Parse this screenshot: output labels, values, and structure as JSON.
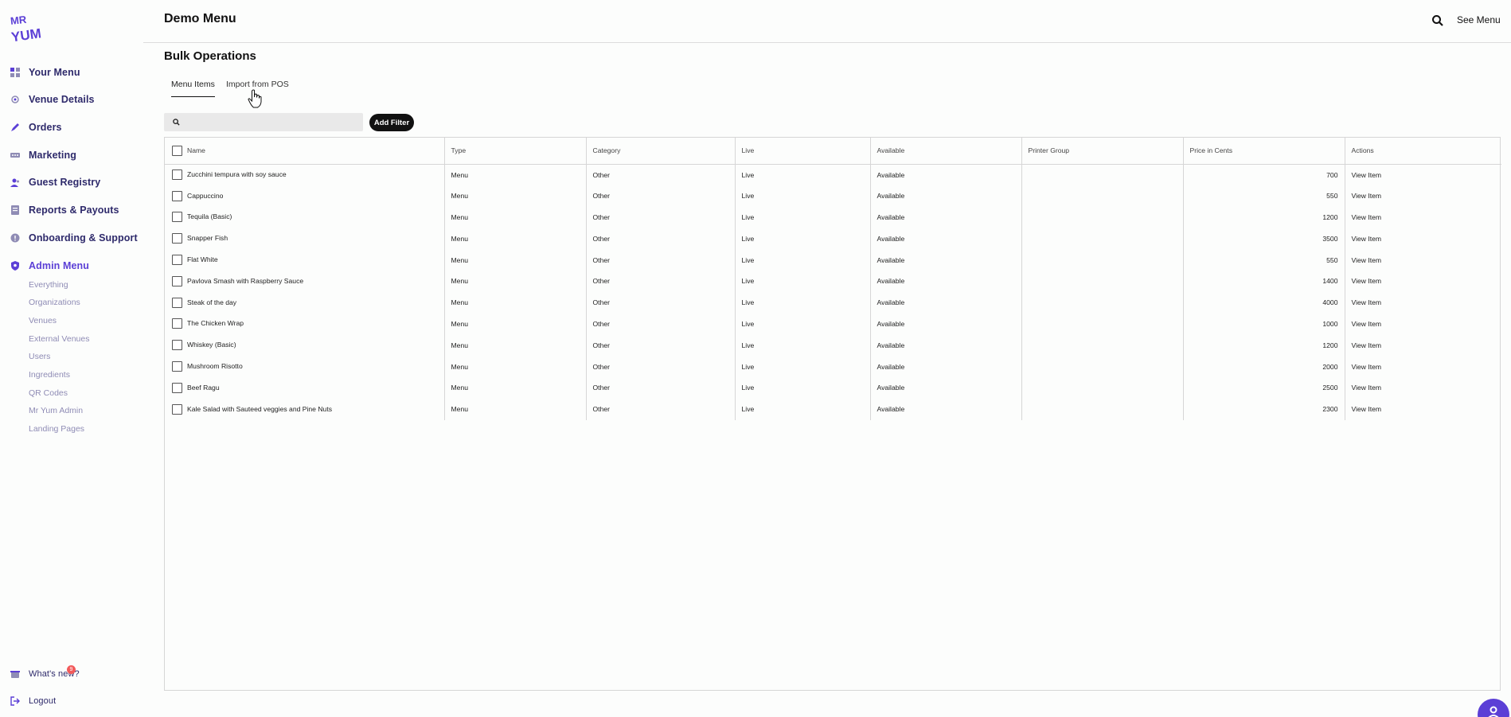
{
  "brand": {
    "logo_text_top": "MR",
    "logo_text_bottom": "YUM",
    "accent": "#5b3fd6"
  },
  "sidebar": {
    "items": [
      {
        "label": "Your Menu",
        "icon": "grid-icon"
      },
      {
        "label": "Venue Details",
        "icon": "store-icon"
      },
      {
        "label": "Orders",
        "icon": "pencil-icon"
      },
      {
        "label": "Marketing",
        "icon": "megaphone-icon"
      },
      {
        "label": "Guest Registry",
        "icon": "guests-icon"
      },
      {
        "label": "Reports & Payouts",
        "icon": "report-icon"
      },
      {
        "label": "Onboarding & Support",
        "icon": "support-icon"
      },
      {
        "label": "Admin Menu",
        "icon": "admin-icon"
      }
    ],
    "sub_items": [
      "Everything",
      "Organizations",
      "Venues",
      "External Venues",
      "Users",
      "Ingredients",
      "QR Codes",
      "Mr Yum Admin",
      "Landing Pages"
    ],
    "whats_new": "What's new?",
    "whats_new_badge": "9",
    "logout": "Logout"
  },
  "header": {
    "title": "Demo Menu",
    "see_menu": "See Menu"
  },
  "main": {
    "section_title": "Bulk Operations",
    "tabs": [
      "Menu Items",
      "Import from POS"
    ],
    "search_placeholder": "",
    "add_filter": "Add Filter"
  },
  "table": {
    "columns": [
      "Name",
      "Type",
      "Category",
      "Live",
      "Available",
      "Printer Group",
      "Price in Cents",
      "Actions"
    ],
    "rows": [
      {
        "name": "Zucchini tempura with soy sauce",
        "type": "Menu",
        "category": "Other",
        "live": "Live",
        "available": "Available",
        "printer_group": "",
        "price": "700",
        "action": "View Item"
      },
      {
        "name": "Cappuccino",
        "type": "Menu",
        "category": "Other",
        "live": "Live",
        "available": "Available",
        "printer_group": "",
        "price": "550",
        "action": "View Item"
      },
      {
        "name": "Tequila (Basic)",
        "type": "Menu",
        "category": "Other",
        "live": "Live",
        "available": "Available",
        "printer_group": "",
        "price": "1200",
        "action": "View Item"
      },
      {
        "name": "Snapper Fish",
        "type": "Menu",
        "category": "Other",
        "live": "Live",
        "available": "Available",
        "printer_group": "",
        "price": "3500",
        "action": "View Item"
      },
      {
        "name": "Flat White",
        "type": "Menu",
        "category": "Other",
        "live": "Live",
        "available": "Available",
        "printer_group": "",
        "price": "550",
        "action": "View Item"
      },
      {
        "name": "Pavlova Smash with Raspberry Sauce",
        "type": "Menu",
        "category": "Other",
        "live": "Live",
        "available": "Available",
        "printer_group": "",
        "price": "1400",
        "action": "View Item"
      },
      {
        "name": "Steak of the day",
        "type": "Menu",
        "category": "Other",
        "live": "Live",
        "available": "Available",
        "printer_group": "",
        "price": "4000",
        "action": "View Item"
      },
      {
        "name": "The Chicken Wrap",
        "type": "Menu",
        "category": "Other",
        "live": "Live",
        "available": "Available",
        "printer_group": "",
        "price": "1000",
        "action": "View Item"
      },
      {
        "name": "Whiskey (Basic)",
        "type": "Menu",
        "category": "Other",
        "live": "Live",
        "available": "Available",
        "printer_group": "",
        "price": "1200",
        "action": "View Item"
      },
      {
        "name": "Mushroom Risotto",
        "type": "Menu",
        "category": "Other",
        "live": "Live",
        "available": "Available",
        "printer_group": "",
        "price": "2000",
        "action": "View Item"
      },
      {
        "name": "Beef Ragu",
        "type": "Menu",
        "category": "Other",
        "live": "Live",
        "available": "Available",
        "printer_group": "",
        "price": "2500",
        "action": "View Item"
      },
      {
        "name": "Kale Salad with Sauteed veggies and Pine Nuts",
        "type": "Menu",
        "category": "Other",
        "live": "Live",
        "available": "Available",
        "printer_group": "",
        "price": "2300",
        "action": "View Item"
      }
    ]
  }
}
